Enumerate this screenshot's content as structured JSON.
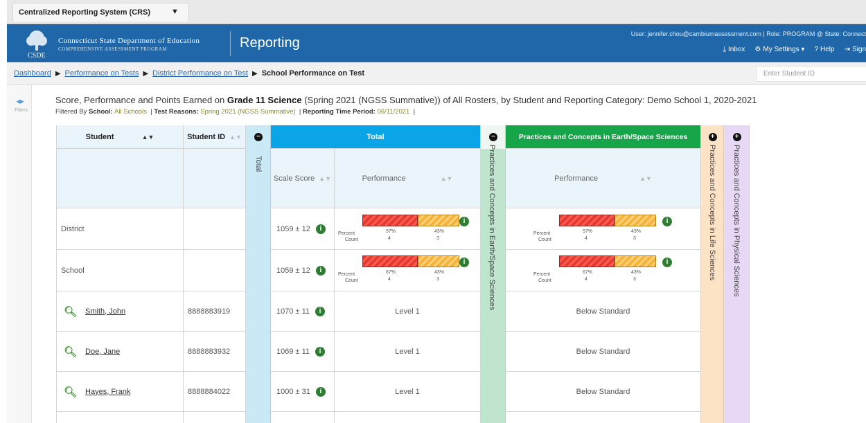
{
  "app_tab": {
    "title": "Centralized Reporting System (CRS)"
  },
  "header": {
    "org_line1": "Connecticut State Department of Education",
    "org_line2": "COMPREHENSIVE ASSESSMENT PROGRAM",
    "logo_text": "CSDE",
    "title": "Reporting",
    "user_line": "User: jennifer.chou@cambiumassessment.com  |  Role: PROGRAM @ State: Connect",
    "inbox": "Inbox",
    "settings": "My Settings",
    "help": "Help",
    "signout": "Sign"
  },
  "breadcrumb": {
    "items": [
      "Dashboard",
      "Performance on Tests",
      "District Performance on Test"
    ],
    "current": "School Performance on Test",
    "student_placeholder": "Enter Student ID"
  },
  "rail": {
    "label": "Filters"
  },
  "report": {
    "title_prefix": "Score, Performance and Points Earned on",
    "title_bold": "Grade 11 Science",
    "title_suffix": "(Spring 2021 (NGSS Summative)) of All Rosters, by Student and Reporting Category: Demo School 1, 2020-2021",
    "filter_label": "Filtered By",
    "f1_key": "School:",
    "f1_val": "All Schools",
    "f2_key": "Test Reasons:",
    "f2_val": "Spring 2021 (NGSS Summative)",
    "f3_key": "Reporting Time Period:",
    "f3_val": "06/11/2021"
  },
  "table": {
    "col_student": "Student",
    "col_student_id": "Student ID",
    "col_total_collapsed": "Total",
    "group_total": "Total",
    "col_scale_score": "Scale Score",
    "col_performance": "Performance",
    "earth_collapsed": "Practices and Concepts in Earth/Space Sciences",
    "group_earth": "Practices and Concepts in Earth/Space Sciences",
    "life_collapsed": "Practices and Concepts in Life Sciences",
    "physical_collapsed": "Practices and Concepts in Physical Sciences",
    "summary_rows": [
      {
        "label": "District",
        "score": "1059 ± 12",
        "total_bar": {
          "red_pct": 57,
          "orange_pct": 43,
          "red_label": "57%",
          "orange_label": "43%",
          "red_count": "4",
          "orange_count": "3"
        },
        "earth_bar": {
          "red_pct": 57,
          "orange_pct": 43,
          "red_label": "57%",
          "orange_label": "43%",
          "red_count": "4",
          "orange_count": "3"
        }
      },
      {
        "label": "School",
        "score": "1059 ± 12",
        "total_bar": {
          "red_pct": 57,
          "orange_pct": 43,
          "red_label": "67%",
          "orange_label": "43%",
          "red_count": "4",
          "orange_count": "3"
        },
        "earth_bar": {
          "red_pct": 57,
          "orange_pct": 43,
          "red_label": "67%",
          "orange_label": "43%",
          "red_count": "4",
          "orange_count": "3"
        }
      }
    ],
    "bar_row_labels": {
      "percent": "Percent",
      "count": "Count"
    },
    "students": [
      {
        "name": "Smith, John",
        "id": "8888883919",
        "score": "1070 ± 11",
        "level": "Level 1",
        "earth": "Below Standard"
      },
      {
        "name": "Doe, Jane",
        "id": "8888883932",
        "score": "1069 ± 11",
        "level": "Level 1",
        "earth": "Below Standard"
      },
      {
        "name": "Hayes, Frank",
        "id": "8888884022",
        "score": "1000 ± 31",
        "level": "Level 1",
        "earth": "Below Standard"
      }
    ]
  },
  "colors": {
    "header_blue": "#1f67a8",
    "total_band": "#c9e9f7",
    "total_header": "#0aa5e6",
    "earth_band": "#bfe5cf",
    "earth_header": "#17a54a",
    "life_band": "#fde3c6",
    "physical_band": "#e7d8f5"
  }
}
